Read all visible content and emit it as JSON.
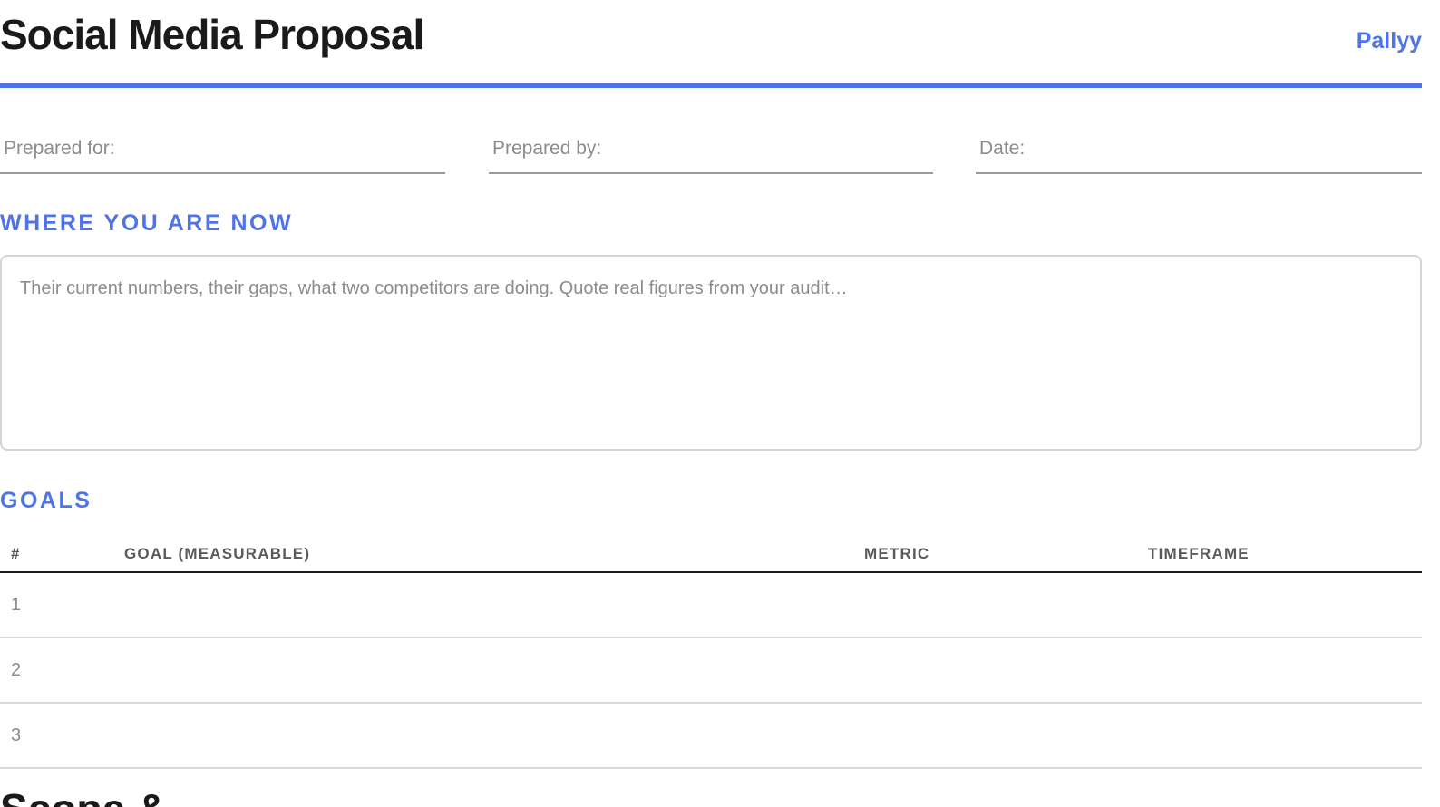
{
  "header": {
    "title": "Social Media Proposal",
    "brand": "Pallyy",
    "accent_color": "#4f74e8"
  },
  "fields": {
    "prepared_for": {
      "placeholder": "Prepared for:",
      "value": ""
    },
    "prepared_by": {
      "placeholder": "Prepared by:",
      "value": ""
    },
    "date": {
      "placeholder": "Date:",
      "value": ""
    }
  },
  "where_you_are_now": {
    "heading": "WHERE YOU ARE NOW",
    "placeholder": "Their current numbers, their gaps, what two competitors are doing. Quote real figures from your audit…",
    "value": ""
  },
  "goals": {
    "heading": "GOALS",
    "columns": [
      "#",
      "GOAL (MEASURABLE)",
      "METRIC",
      "TIMEFRAME"
    ],
    "rows": [
      {
        "num": "1",
        "goal": "",
        "metric": "",
        "timeframe": ""
      },
      {
        "num": "2",
        "goal": "",
        "metric": "",
        "timeframe": ""
      },
      {
        "num": "3",
        "goal": "",
        "metric": "",
        "timeframe": ""
      }
    ]
  },
  "next_section": {
    "heading_partial": "Scope &"
  }
}
